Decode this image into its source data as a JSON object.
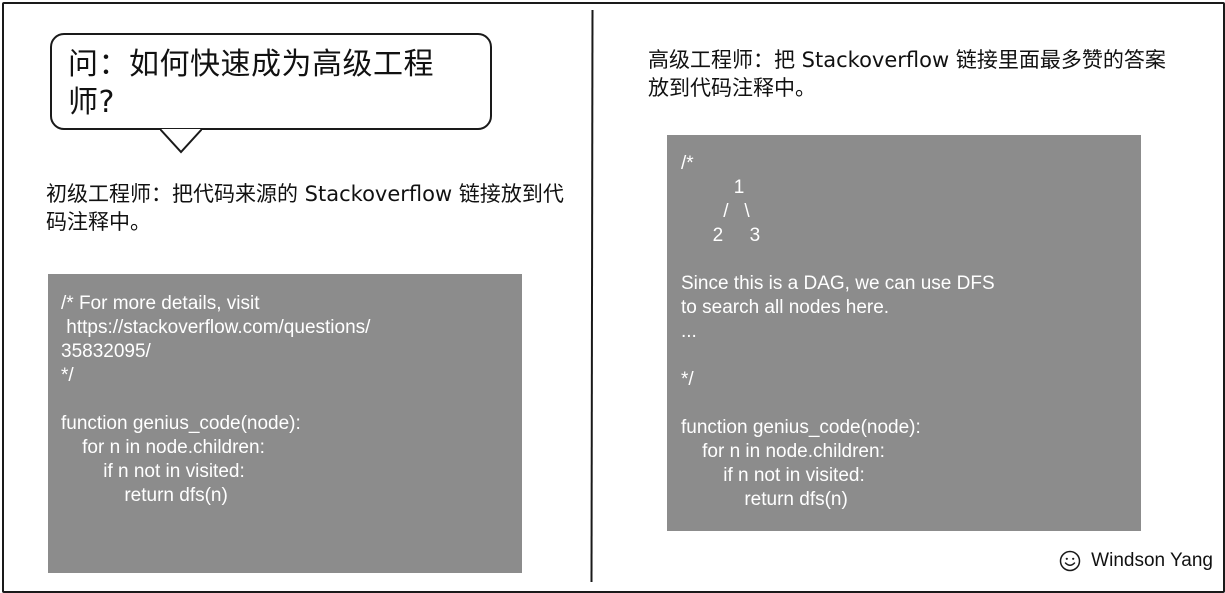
{
  "question": "问：如何快速成为高级工程师?",
  "junior": "初级工程师：把代码来源的 Stackoverflow 链接放到代码注释中。",
  "senior": "高级工程师：把 Stackoverflow 链接里面最多赞的答案放到代码注释中。",
  "left_code": [
    "/* For more details, visit",
    " https://stackoverflow.com/questions/",
    "35832095/",
    "*/",
    "",
    "function genius_code(node):",
    "    for n in node.children:",
    "        if n not in visited:",
    "            return dfs(n)"
  ],
  "right_code": [
    "/*",
    "          1",
    "        /   \\",
    "      2     3",
    "",
    "Since this is a DAG, we can use DFS",
    "to search all nodes here.",
    "...",
    "",
    "*/",
    "",
    "function genius_code(node):",
    "    for n in node.children:",
    "        if n not in visited:",
    "            return dfs(n)"
  ],
  "signature": {
    "icon": "smiley-icon",
    "name": "Windson Yang"
  },
  "colors": {
    "code_background": "#8c8c8c",
    "code_text": "#ffffff",
    "ink": "#1a1a1a"
  }
}
